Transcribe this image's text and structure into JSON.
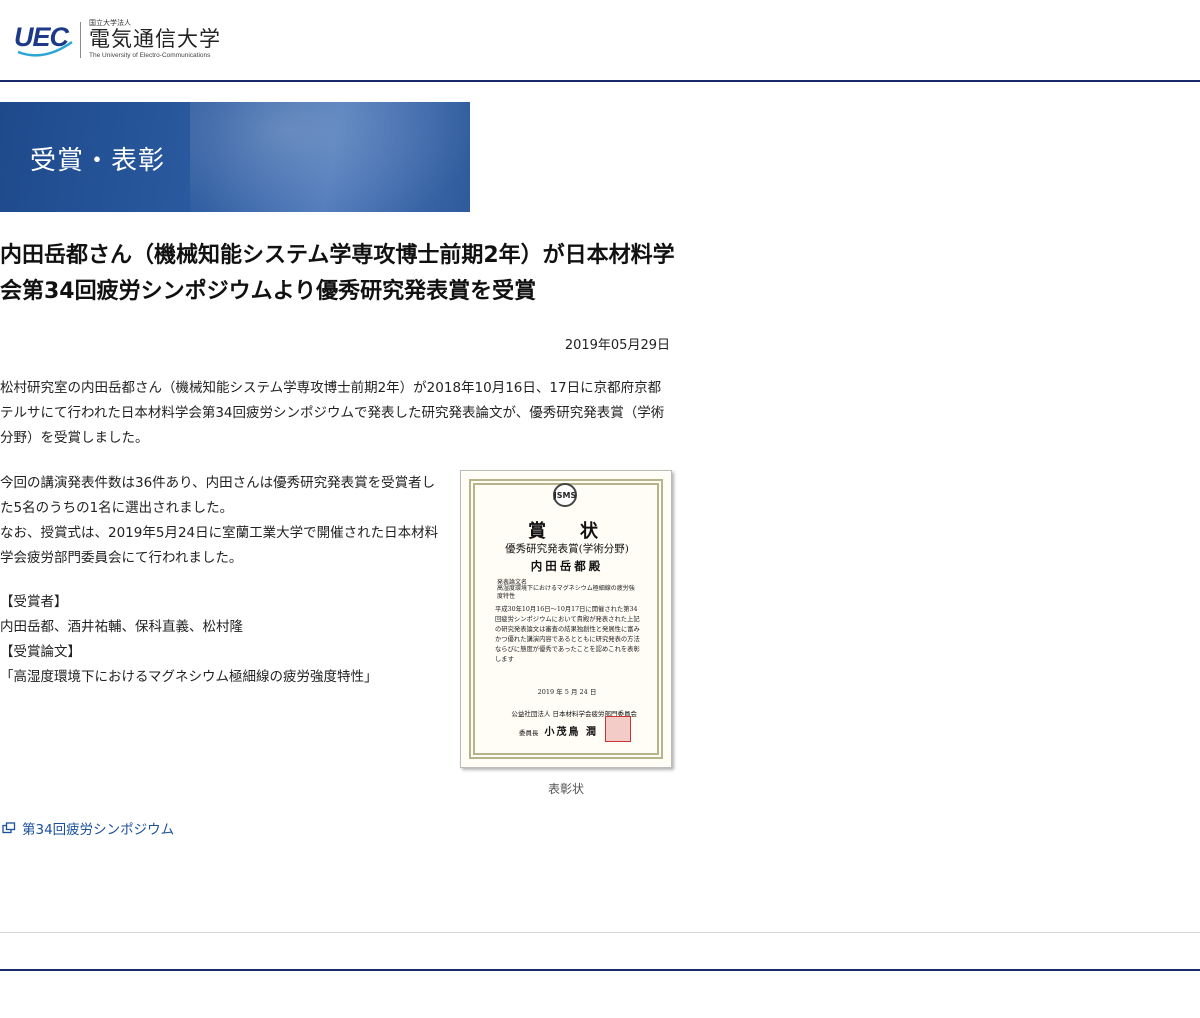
{
  "header": {
    "logo_mark": "UEC",
    "logo_small": "国立大学法人",
    "logo_name": "電気通信大学",
    "logo_en": "The University of Electro-Communications"
  },
  "banner": {
    "title": "受賞・表彰"
  },
  "article": {
    "title": "内田岳都さん（機械知能システム学専攻博士前期2年）が日本材料学会第34回疲労シンポジウムより優秀研究発表賞を受賞",
    "date": "2019年05月29日",
    "p1": "松村研究室の内田岳都さん（機械知能システム学専攻博士前期2年）が2018年10月16日、17日に京都府京都テルサにて行われた日本材料学会第34回疲労シンポジウムで発表した研究発表論文が、優秀研究発表賞（学術分野）を受賞しました。",
    "p2_line1": "今回の講演発表件数は36件あり、内田さんは優秀研究発表賞を受賞者した5名のうちの1名に選出されました。",
    "p2_line2": "なお、授賞式は、2019年5月24日に室蘭工業大学で開催された日本材料学会疲労部門委員会にて行われました。",
    "recipients_heading": "【受賞者】",
    "recipients": "内田岳都、酒井祐輔、保科直義、松村隆",
    "paper_heading": "【受賞論文】",
    "paper_title": "「高湿度環境下におけるマグネシウム極細線の疲労強度特性」"
  },
  "figure": {
    "caption": "表彰状",
    "certificate": {
      "seal": "JSMS",
      "heading": "賞　状",
      "award": "優秀研究発表賞(学術分野)",
      "recipient": "内田岳都殿",
      "paper_label": "発表論文名",
      "paper": "高湿度環境下におけるマグネシウム極細線の疲労強度特性",
      "body": "平成30年10月16日〜10月17日に開催された第34回疲労シンポジウムにおいて貴殿が発表された上記の研究発表論文は審査の結果独創性と発展性に富みかつ優れた講演内容であるとともに研究発表の方法ならびに態度が優秀であったことを認めこれを表彰します",
      "date": "2019 年 5 月 24 日",
      "org": "公益社団法人 日本材料学会疲労部門委員会",
      "chair_title": "委員長",
      "chair_name": "小茂鳥 潤"
    }
  },
  "link": {
    "label": "第34回疲労シンポジウム"
  },
  "colors": {
    "brand_navy": "#1b2a6b",
    "link_blue": "#1a4f9c",
    "banner_blue": "#2b5aa0"
  }
}
